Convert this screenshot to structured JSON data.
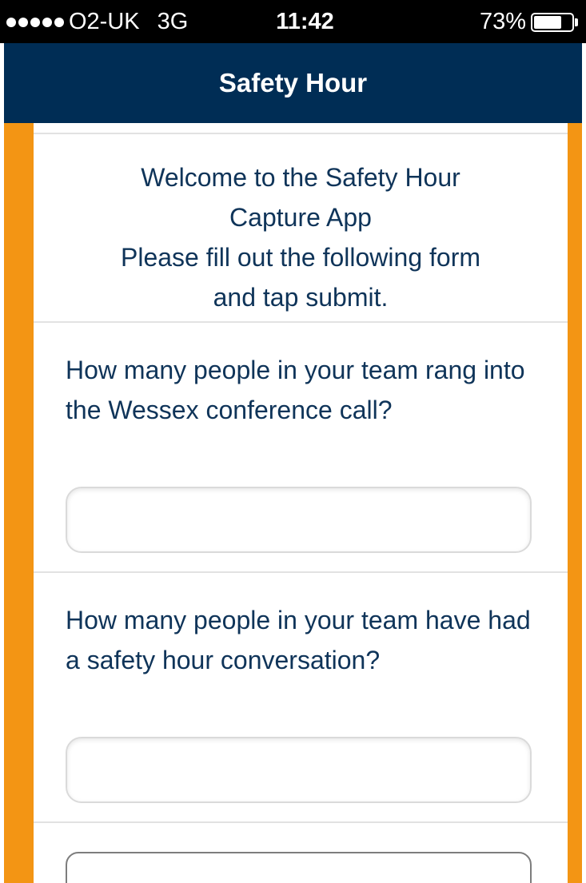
{
  "status_bar": {
    "carrier": "O2-UK",
    "network": "3G",
    "time": "11:42",
    "battery_percent": "73%",
    "battery_level": 0.73,
    "signal_bars": 5
  },
  "header": {
    "title": "Safety Hour"
  },
  "welcome": {
    "line1": "Welcome to the Safety Hour",
    "line2": "Capture App",
    "line3": "Please fill out the following form",
    "line4": "and tap submit."
  },
  "questions": [
    {
      "label": "How many people in your team rang into the Wessex conference call?",
      "value": "",
      "placeholder": ""
    },
    {
      "label": "How many people in your team have had a safety hour conversation?",
      "value": "",
      "placeholder": ""
    }
  ],
  "third_field": {
    "value": "",
    "placeholder": ""
  },
  "colors": {
    "header_bg": "#002d55",
    "accent_orange": "#f39514",
    "text_navy": "#0f3459",
    "divider": "#e2e2e2"
  }
}
